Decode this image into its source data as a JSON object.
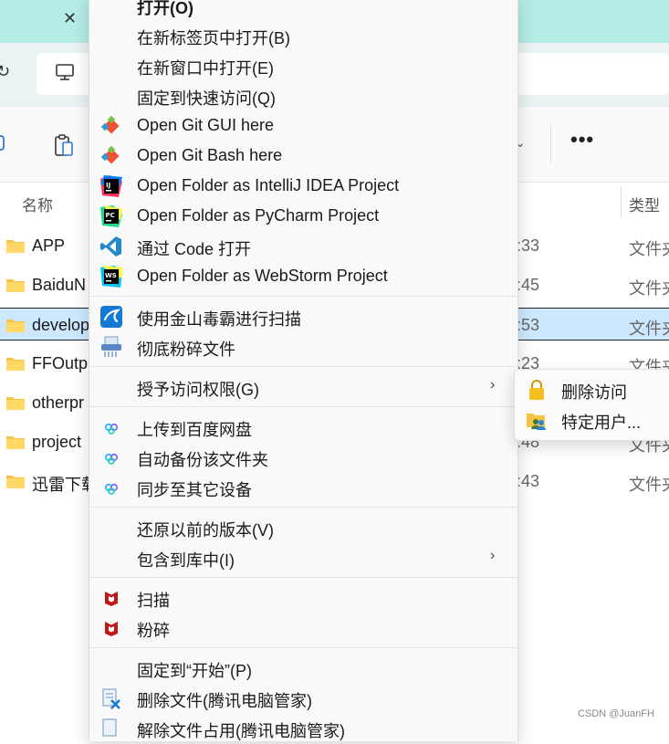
{
  "explorer": {
    "column_headers": {
      "name": "名称",
      "type": "类型"
    },
    "rows": [
      {
        "name": "APP",
        "time": ":33",
        "type": "文件夹",
        "selected": false
      },
      {
        "name": "BaiduN",
        "time": ":45",
        "type": "文件夹",
        "selected": false
      },
      {
        "name": "develop",
        "time": ":53",
        "type": "文件夹",
        "selected": true
      },
      {
        "name": "FFOutp",
        "time": ":23",
        "type": "文件夹",
        "selected": false
      },
      {
        "name": "otherpr",
        "time": "",
        "type": "文件夹",
        "selected": false
      },
      {
        "name": "project",
        "time": ":48",
        "type": "文件夹",
        "selected": false
      },
      {
        "name": "迅雷下载",
        "time": ":43",
        "type": "文件夹",
        "selected": false
      }
    ],
    "toolbar": {
      "more_label": "•••"
    }
  },
  "context_menu": {
    "open": "打开(O)",
    "open_new_tab": "在新标签页中打开(B)",
    "open_new_window": "在新窗口中打开(E)",
    "pin_quick_access": "固定到快速访问(Q)",
    "git_gui": "Open Git GUI here",
    "git_bash": "Open Git Bash here",
    "intellij": "Open Folder as IntelliJ IDEA Project",
    "pycharm": "Open Folder as PyCharm Project",
    "vscode": "通过 Code 打开",
    "webstorm": "Open Folder as WebStorm Project",
    "kingsoft_scan": "使用金山毒霸进行扫描",
    "shred": "彻底粉碎文件",
    "give_access": "授予访问权限(G)",
    "baidu_upload": "上传到百度网盘",
    "baidu_backup": "自动备份该文件夹",
    "baidu_sync": "同步至其它设备",
    "restore_versions": "还原以前的版本(V)",
    "include_library": "包含到库中(I)",
    "mcafee_scan": "扫描",
    "mcafee_shred": "粉碎",
    "pin_start": "固定到“开始”(P)",
    "tencent_delete": "删除文件(腾讯电脑管家)",
    "tencent_unlock": "解除文件占用(腾讯电脑管家)"
  },
  "submenu": {
    "remove_access": "删除访问",
    "specific_users": "特定用户..."
  },
  "watermark": "CSDN @JuanFH",
  "colors": {
    "titlebar": "#b6ece6",
    "selection": "#cce8ff",
    "folder": "#f6c343",
    "vscode": "#2489ca",
    "mcafee": "#c01818",
    "git": "#f05033"
  }
}
